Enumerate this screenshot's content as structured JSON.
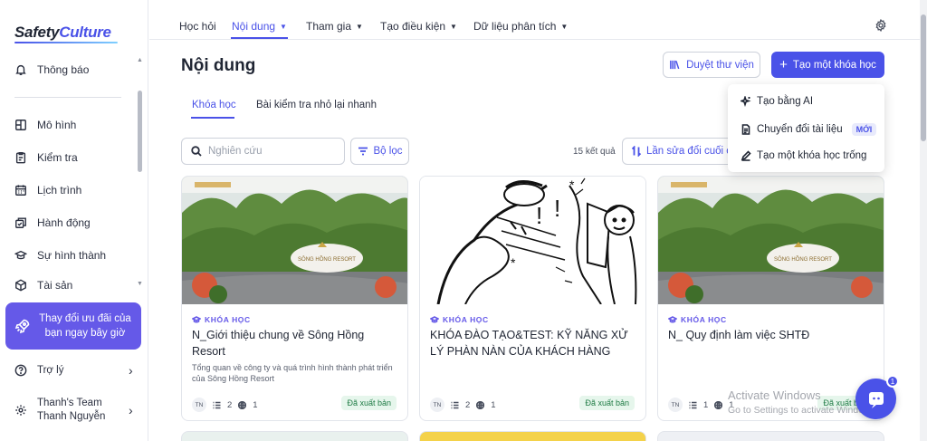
{
  "brand": {
    "logo_part1": "Safety",
    "logo_part2": "Culture"
  },
  "sidebar": {
    "items": [
      {
        "label": "Thông báo",
        "icon": "bell-icon"
      },
      {
        "label": "Mô hình",
        "icon": "template-icon"
      },
      {
        "label": "Kiểm tra",
        "icon": "inspection-icon"
      },
      {
        "label": "Lịch trình",
        "icon": "calendar-icon"
      },
      {
        "label": "Hành động",
        "icon": "actions-icon"
      },
      {
        "label": "Sự hình thành",
        "icon": "training-cap-icon"
      },
      {
        "label": "Tài sản",
        "icon": "asset-icon"
      }
    ],
    "upgrade_label": "Thay đổi ưu đãi của bạn ngay bây giờ",
    "help_label": "Trợ lý",
    "team_name": "Thanh's Team",
    "user_name": "Thanh Nguyễn"
  },
  "topnav": {
    "items": [
      {
        "label": "Học hỏi",
        "has_caret": false
      },
      {
        "label": "Nội dung",
        "has_caret": true,
        "active": true
      },
      {
        "label": "Tham gia",
        "has_caret": true
      },
      {
        "label": "Tạo điều kiện",
        "has_caret": true
      },
      {
        "label": "Dữ liệu phân tích",
        "has_caret": true
      }
    ]
  },
  "main": {
    "title": "Nội dung",
    "library_button": "Duyệt thư viện",
    "create_button": "Tạo một khóa học",
    "tabs": [
      {
        "label": "Khóa học",
        "active": true
      },
      {
        "label": "Bài kiểm tra nhỏ lại nhanh",
        "active": false
      }
    ],
    "search_placeholder": "Nghiên cứu",
    "filter_label": "Bộ lọc",
    "result_count": "15 kết quả",
    "sort_label": "Lần sửa đổi cuối cùng"
  },
  "dropdown": {
    "items": [
      {
        "label": "Tạo bằng AI",
        "icon": "sparkle-icon"
      },
      {
        "label": "Chuyển đổi tài liệu",
        "icon": "document-icon",
        "badge": "MỚI"
      },
      {
        "label": "Tạo một khóa học trống",
        "icon": "pencil-icon"
      }
    ]
  },
  "cards": [
    {
      "type_label": "KHÓA HỌC",
      "title": "N_Giới thiệu chung về Sông Hồng Resort",
      "description": "Tổng quan về công ty và quá trình hình thành phát triển của Sông Hồng Resort",
      "avatar": "TN",
      "lessons": "2",
      "sites": "1",
      "status": "Đã xuất bản",
      "image": "resort-photo",
      "sign_text": "SÔNG HỒNG RESORT"
    },
    {
      "type_label": "KHÓA HỌC",
      "title": "KHÓA ĐÀO TẠO&TEST: KỸ NĂNG XỬ LÝ PHÀN NÀN CỦA KHÁCH HÀNG",
      "description": "",
      "avatar": "TN",
      "lessons": "2",
      "sites": "1",
      "status": "Đã xuất bản",
      "image": "cartoon-illustration"
    },
    {
      "type_label": "KHÓA HỌC",
      "title": "N_ Quy định làm việc SHTĐ",
      "description": "",
      "avatar": "TN",
      "lessons": "1",
      "sites": "1",
      "status": "Đã xuất bản",
      "image": "resort-photo",
      "sign_text": "SÔNG HỒNG RESORT"
    }
  ],
  "watermark": {
    "line1": "Activate Windows",
    "line2": "Go to Settings to activate Windows."
  },
  "chat": {
    "badge": "1"
  },
  "colors": {
    "accent": "#4a52e8",
    "upgrade": "#6559e8",
    "published_bg": "#e6f6ec",
    "published_text": "#1d7a43"
  }
}
